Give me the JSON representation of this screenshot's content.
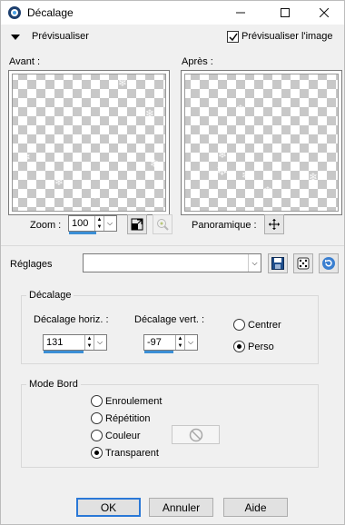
{
  "window": {
    "title": "Décalage"
  },
  "icons": {
    "app": "app-icon",
    "minimize": "minimize-icon",
    "maximize": "maximize-icon",
    "close": "close-icon",
    "collapse": "triangle-down-icon",
    "zoom_fit": "zoom-to-fit-icon",
    "zoom_actual": "zoom-actual-size-icon",
    "pan": "pan-move-icon",
    "save": "save-icon",
    "randomize": "dice-icon",
    "reset": "reset-icon",
    "no_color": "no-color-icon"
  },
  "preview_bar": {
    "label": "Prévisualiser",
    "checkbox_label": "Prévisualiser l'image",
    "checked": true
  },
  "before": {
    "label": "Avant :"
  },
  "after": {
    "label": "Après :"
  },
  "zoom": {
    "label": "Zoom :",
    "value": "100"
  },
  "pan": {
    "label": "Panoramique :"
  },
  "settings": {
    "label": "Réglages",
    "value": ""
  },
  "offset_group": {
    "title": "Décalage",
    "horiz_label": "Décalage horiz. :",
    "horiz_value": "131",
    "vert_label": "Décalage vert. :",
    "vert_value": "-97",
    "options": [
      {
        "label": "Centrer",
        "selected": false
      },
      {
        "label": "Perso",
        "selected": true
      }
    ]
  },
  "edge_group": {
    "title": "Mode Bord",
    "options": [
      {
        "label": "Enroulement",
        "selected": false
      },
      {
        "label": "Répétition",
        "selected": false
      },
      {
        "label": "Couleur",
        "selected": false
      },
      {
        "label": "Transparent",
        "selected": true
      }
    ]
  },
  "buttons": {
    "ok": "OK",
    "cancel": "Annuler",
    "help": "Aide"
  },
  "colors": {
    "accent": "#3b8fd6",
    "default_border": "#2a78d7",
    "window_bg": "#f0f0f0"
  }
}
